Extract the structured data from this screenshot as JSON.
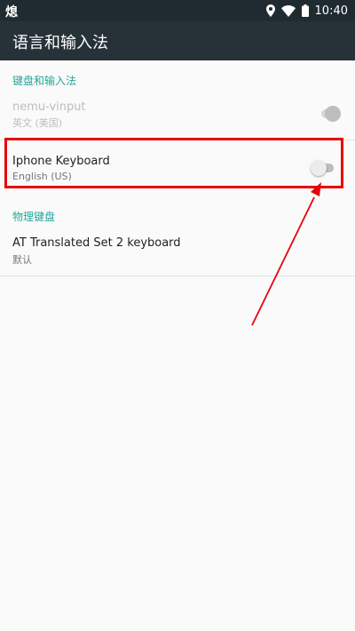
{
  "status_bar": {
    "left_glyph": "熄",
    "time": "10:40",
    "icons": [
      "location-icon",
      "wifi-icon",
      "battery-icon"
    ]
  },
  "app_bar": {
    "title": "语言和输入法"
  },
  "sections": {
    "keyboard": {
      "header": "键盘和输入法",
      "items": [
        {
          "title": "nemu-vinput",
          "subtitle": "英文 (美国)",
          "enabled": false,
          "toggle_on": false
        },
        {
          "title": "Iphone Keyboard",
          "subtitle": "English (US)",
          "enabled": true,
          "toggle_on": false
        }
      ]
    },
    "physical": {
      "header": "物理键盘",
      "items": [
        {
          "title": "AT Translated Set 2 keyboard",
          "subtitle": "默认"
        }
      ]
    }
  },
  "colors": {
    "status_bar_bg": "#1f2b31",
    "app_bar_bg": "#263238",
    "section_header": "#26a69a",
    "highlight": "#e8000b"
  }
}
